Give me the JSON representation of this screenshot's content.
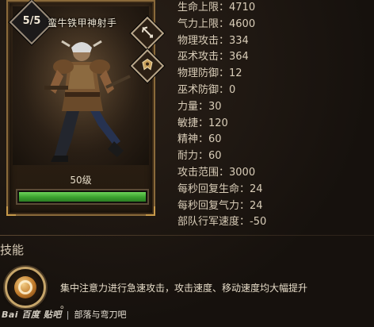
{
  "unit": {
    "badge": "5/5",
    "name": "蛮牛铁甲神射手",
    "level": "50级",
    "health_fill": 1.0
  },
  "icons": {
    "side_top": "crossbow-icon",
    "side_bottom": "crest-icon"
  },
  "stats": [
    "生命上限：4710",
    "气力上限：4600",
    "物理攻击：334",
    "巫术攻击：364",
    "物理防御：12",
    "巫术防御：0",
    "力量：30",
    "敏捷：120",
    "精神：60",
    "耐力：60",
    "攻击范围：3000",
    "每秒回复生命：24",
    "每秒回复气力：24",
    "部队行军速度：-50"
  ],
  "skills": {
    "title": "技能",
    "desc_line1": "集中注意力进行急速攻击，攻击速度、移动速度均大幅提升",
    "desc_line2": "。"
  },
  "watermark": {
    "logo": "Bai 百度 贴吧",
    "source": "部落与弯刀吧"
  },
  "colors": {
    "health_bar": "#3aa02e",
    "frame": "#8a6a3a"
  }
}
